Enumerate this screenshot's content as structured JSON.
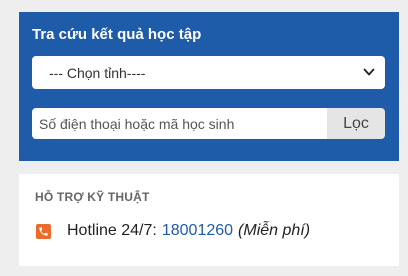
{
  "lookup": {
    "title": "Tra cứu kết quả học tập",
    "province_select": {
      "selected": "--- Chọn tỉnh----"
    },
    "search": {
      "placeholder": "Số điện thoại hoặc mã học sinh",
      "value": ""
    },
    "filter_button": "Lọc"
  },
  "support": {
    "heading": "HỖ TRỢ KỸ THUẬT",
    "hotline_label": "Hotline 24/7:",
    "hotline_number": "18001260",
    "hotline_note": "(Miễn phí)"
  },
  "colors": {
    "panel_bg": "#1e5ba8",
    "page_bg": "#eeeeee",
    "phone_icon": "#ec6a2c",
    "link": "#1e5ba8"
  },
  "icons": {
    "select_arrow": "chevron-down-icon",
    "hotline": "phone-icon"
  }
}
